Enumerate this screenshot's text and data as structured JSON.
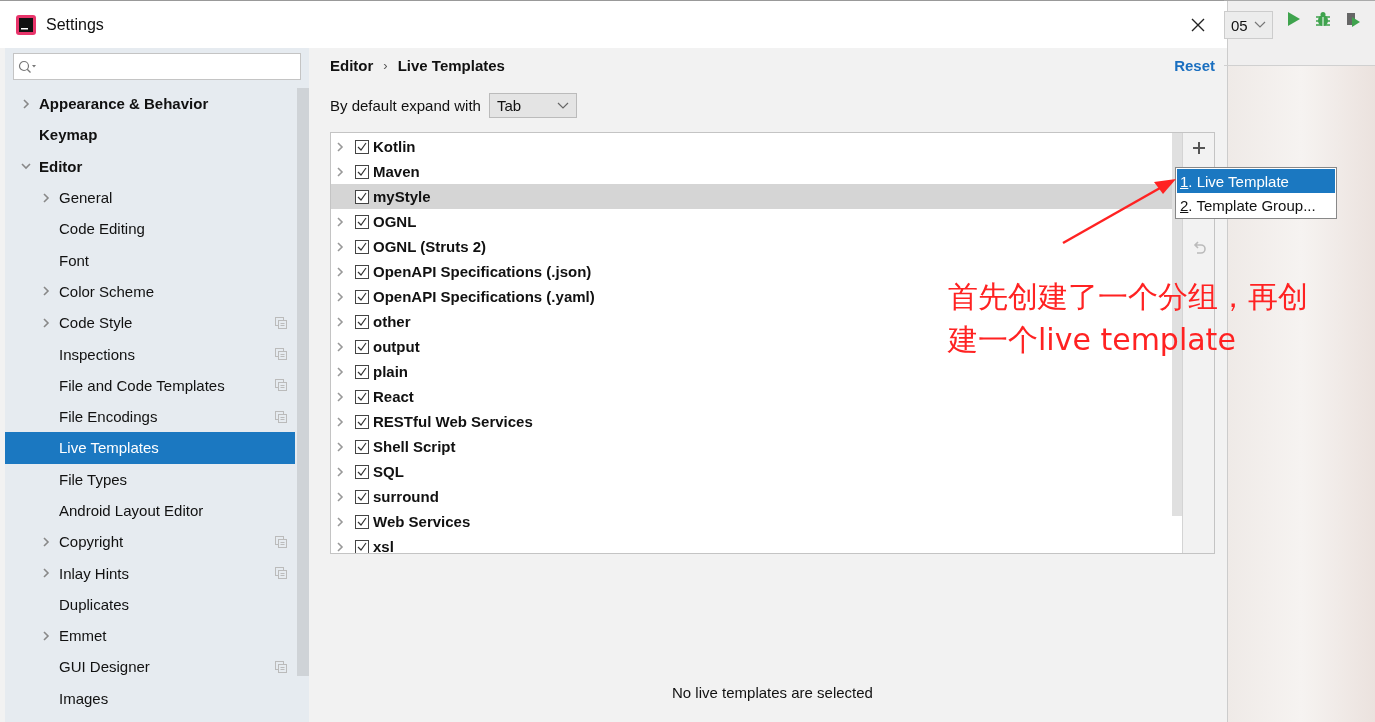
{
  "window": {
    "title": "Settings"
  },
  "ide_toolbar": {
    "config_label": "05"
  },
  "sidebar": {
    "items": [
      {
        "label": "Appearance & Behavior",
        "expanded": false,
        "selected": false
      },
      {
        "label": "Keymap",
        "selected": false
      },
      {
        "label": "Editor",
        "expanded": true,
        "selected": false,
        "children": [
          {
            "label": "General",
            "expanded": false,
            "selected": false
          },
          {
            "label": "Code Editing",
            "selected": false
          },
          {
            "label": "Font",
            "selected": false
          },
          {
            "label": "Color Scheme",
            "expanded": false,
            "selected": false
          },
          {
            "label": "Code Style",
            "expanded": false,
            "selected": false,
            "shared": true
          },
          {
            "label": "Inspections",
            "selected": false,
            "shared": true
          },
          {
            "label": "File and Code Templates",
            "selected": false,
            "shared": true
          },
          {
            "label": "File Encodings",
            "selected": false,
            "shared": true
          },
          {
            "label": "Live Templates",
            "selected": true
          },
          {
            "label": "File Types",
            "selected": false
          },
          {
            "label": "Android Layout Editor",
            "selected": false
          },
          {
            "label": "Copyright",
            "expanded": false,
            "selected": false,
            "shared": true
          },
          {
            "label": "Inlay Hints",
            "expanded": false,
            "selected": false,
            "shared": true
          },
          {
            "label": "Duplicates",
            "selected": false
          },
          {
            "label": "Emmet",
            "expanded": false,
            "selected": false
          },
          {
            "label": "GUI Designer",
            "selected": false,
            "shared": true
          },
          {
            "label": "Images",
            "selected": false
          }
        ]
      }
    ]
  },
  "content": {
    "breadcrumb": [
      "Editor",
      "Live Templates"
    ],
    "separator": "›",
    "reset": "Reset",
    "expand_label": "By default expand with",
    "expand_value": "Tab",
    "templates": [
      {
        "label": "Kotlin",
        "checked": true,
        "expandable": true,
        "selected": false
      },
      {
        "label": "Maven",
        "checked": true,
        "expandable": true,
        "selected": false
      },
      {
        "label": "myStyle",
        "checked": true,
        "selected": true
      },
      {
        "label": "OGNL",
        "checked": true,
        "expandable": true,
        "selected": false
      },
      {
        "label": "OGNL (Struts 2)",
        "checked": true,
        "expandable": true,
        "selected": false
      },
      {
        "label": "OpenAPI Specifications (.json)",
        "checked": true,
        "expandable": true,
        "selected": false
      },
      {
        "label": "OpenAPI Specifications (.yaml)",
        "checked": true,
        "expandable": true,
        "selected": false
      },
      {
        "label": "other",
        "checked": true,
        "expandable": true,
        "selected": false
      },
      {
        "label": "output",
        "checked": true,
        "expandable": true,
        "selected": false
      },
      {
        "label": "plain",
        "checked": true,
        "expandable": true,
        "selected": false
      },
      {
        "label": "React",
        "checked": true,
        "expandable": true,
        "selected": false
      },
      {
        "label": "RESTful Web Services",
        "checked": true,
        "expandable": true,
        "selected": false
      },
      {
        "label": "Shell Script",
        "checked": true,
        "expandable": true,
        "selected": false
      },
      {
        "label": "SQL",
        "checked": true,
        "expandable": true,
        "selected": false
      },
      {
        "label": "surround",
        "checked": true,
        "expandable": true,
        "selected": false
      },
      {
        "label": "Web Services",
        "checked": true,
        "expandable": true,
        "selected": false
      },
      {
        "label": "xsl",
        "checked": true,
        "expandable": true,
        "selected": false
      }
    ],
    "add_menu": [
      {
        "mnemonic": "1",
        "label": ". Live Template",
        "selected": true
      },
      {
        "mnemonic": "2",
        "label": ". Template Group...",
        "selected": false
      }
    ],
    "empty_message": "No live templates are selected"
  },
  "annotation": {
    "text": "首先创建了一个分组，再创建一个live template"
  }
}
